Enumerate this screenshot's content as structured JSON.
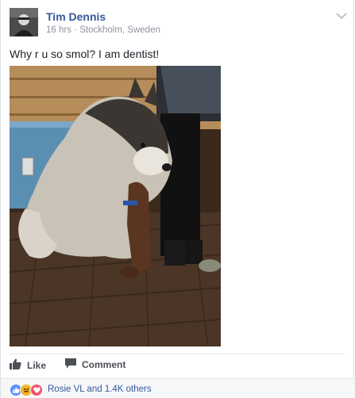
{
  "post": {
    "author": "Tim Dennis",
    "timestamp": "16 hrs",
    "separator": "·",
    "location": "Stockholm, Sweden",
    "text": "Why r u so smol? I am dentist!",
    "photo_alt": "dog photo"
  },
  "actions": {
    "like_label": "Like",
    "comment_label": "Comment"
  },
  "reactions": {
    "icons": [
      "like-reaction-icon",
      "haha-reaction-icon",
      "love-reaction-icon"
    ],
    "summary": "Rosie VL and 1.4K others"
  },
  "colors": {
    "name_link": "#365899",
    "meta_gray": "#90949c",
    "action_gray": "#4b4f56",
    "like_blue": "#5890ff",
    "haha_yellow": "#f7b125",
    "love_red": "#f25268",
    "footer_bg": "#f6f7f9"
  }
}
